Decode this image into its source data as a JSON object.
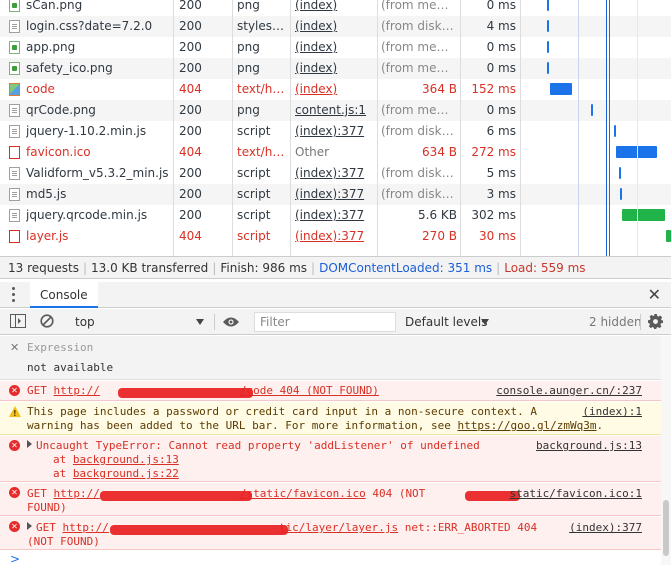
{
  "network": {
    "rows": [
      {
        "name": "sCan.png",
        "status": "200",
        "type": "png",
        "initiator": "(index)",
        "size": "(from memo...",
        "time": "0 ms",
        "icon": "image-file-icon",
        "error": false
      },
      {
        "name": "login.css?date=7.2.0",
        "status": "200",
        "type": "stylesh...",
        "initiator": "(index)",
        "size": "(from disk c...",
        "time": "4 ms",
        "icon": "document-file-icon",
        "error": false
      },
      {
        "name": "app.png",
        "status": "200",
        "type": "png",
        "initiator": "(index)",
        "size": "(from memo...",
        "time": "0 ms",
        "icon": "image-file-icon",
        "error": false
      },
      {
        "name": "safety_ico.png",
        "status": "200",
        "type": "png",
        "initiator": "(index)",
        "size": "(from memo...",
        "time": "0 ms",
        "icon": "image-file-icon",
        "error": false
      },
      {
        "name": "code",
        "status": "404",
        "type": "text/html",
        "initiator": "(index)",
        "size": "364 B",
        "time": "152 ms",
        "icon": "picture-file-icon",
        "error": true
      },
      {
        "name": "qrCode.png",
        "status": "200",
        "type": "png",
        "initiator": "content.js:1",
        "size": "(from memo...",
        "time": "0 ms",
        "icon": "document-file-icon",
        "error": false
      },
      {
        "name": "jquery-1.10.2.min.js",
        "status": "200",
        "type": "script",
        "initiator": "(index):377",
        "size": "(from disk c...",
        "time": "6 ms",
        "icon": "document-file-icon",
        "error": false
      },
      {
        "name": "favicon.ico",
        "status": "404",
        "type": "text/html",
        "initiator": "Other",
        "size": "634 B",
        "time": "272 ms",
        "icon": "error-file-icon",
        "error": true
      },
      {
        "name": "Validform_v5.3.2_min.js",
        "status": "200",
        "type": "script",
        "initiator": "(index):377",
        "size": "(from disk c...",
        "time": "5 ms",
        "icon": "document-file-icon",
        "error": false
      },
      {
        "name": "md5.js",
        "status": "200",
        "type": "script",
        "initiator": "(index):377",
        "size": "(from disk c...",
        "time": "3 ms",
        "icon": "document-file-icon",
        "error": false
      },
      {
        "name": "jquery.qrcode.min.js",
        "status": "200",
        "type": "script",
        "initiator": "(index):377",
        "size": "5.6 KB",
        "time": "302 ms",
        "icon": "document-file-icon",
        "error": false
      },
      {
        "name": "layer.js",
        "status": "404",
        "type": "script",
        "initiator": "(index):377",
        "size": "270 B",
        "time": "30 ms",
        "icon": "error-file-icon",
        "error": true
      }
    ],
    "colors": {
      "waiting": "#1a73e8",
      "download": "#20b34a",
      "dcl_line": "#1a5fd8",
      "load_line": "#c8372d",
      "error_text": "#d93025"
    }
  },
  "summary": {
    "requests": "13 requests",
    "transferred": "13.0 KB transferred",
    "finish": "Finish: 986 ms",
    "dcl": "DOMContentLoaded: 351 ms",
    "load": "Load: 559 ms"
  },
  "drawer": {
    "tab": "Console",
    "close_icon": "close-icon"
  },
  "toolbar": {
    "context": "top",
    "filter_placeholder": "Filter",
    "levels": "Default levels",
    "hidden": "2 hidden"
  },
  "console": {
    "expression_label": "Expression",
    "expression_value": "not available",
    "messages": [
      {
        "level": "error",
        "text_parts": [
          "GET ",
          "http://",
          "/code 404 (NOT FOUND)"
        ],
        "source": "console.aunger.cn/:237"
      },
      {
        "level": "warning",
        "line1": "This page includes a password or credit card input in a non-secure context. A",
        "line2_prefix": "warning has been added to the URL bar. For more information, see ",
        "line2_link": "https://goo.gl/zmWq3m",
        "line2_suffix": ".",
        "source": "(index):1"
      },
      {
        "level": "error",
        "line1": "Uncaught TypeError: Cannot read property 'addListener' of undefined",
        "stack": [
          "at background.js:13",
          "at background.js:22"
        ],
        "stack_links": [
          "background.js:13",
          "background.js:22"
        ],
        "source": "background.js:13"
      },
      {
        "level": "error",
        "line1_prefix": "GET ",
        "line1_link_a": "http://",
        "line1_link_b": "/static/favicon.ico",
        "line1_suffix": " 404 (NOT",
        "line2": "FOUND)",
        "source": "static/favicon.ico:1"
      },
      {
        "level": "error",
        "line1_prefix": "GET ",
        "line1_link_a": "http://",
        "line1_link_b": "tic/layer/layer.js",
        "line1_suffix": " net::ERR_ABORTED 404",
        "line2": "(NOT FOUND)",
        "source": "(index):377"
      }
    ],
    "prompt": ">"
  }
}
